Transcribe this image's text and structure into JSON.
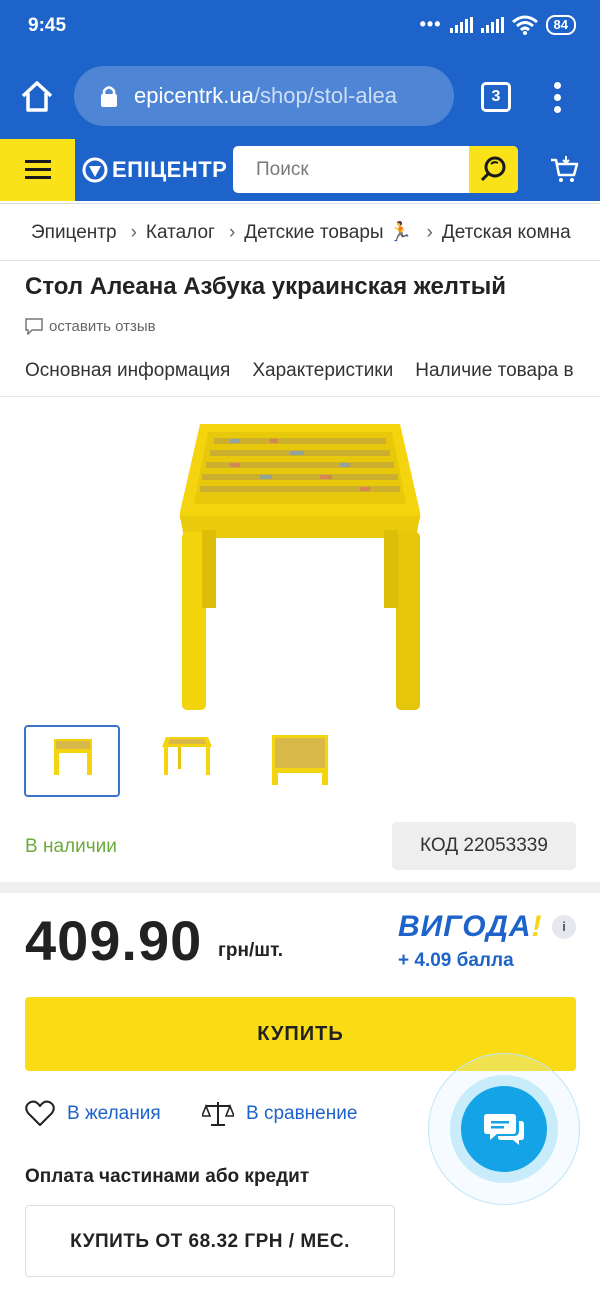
{
  "status_bar": {
    "time": "9:45",
    "battery": "84"
  },
  "browser": {
    "url_domain": "epicentrk.ua",
    "url_path": "/shop/stol-alea",
    "tab_count": "3"
  },
  "site_header": {
    "logo_text": "ЕПІЦЕНТР",
    "search_placeholder": "Поиск"
  },
  "breadcrumbs": [
    "Эпицентр",
    "Каталог",
    "Детские товары 🏃",
    "Детская комна"
  ],
  "product": {
    "title": "Стол Алеана Азбука украинская желтый",
    "review_link": "оставить отзыв",
    "tabs": [
      "Основная информация",
      "Характеристики",
      "Наличие товара в"
    ],
    "availability": "В наличии",
    "code": "КОД 22053339",
    "price": "409.90",
    "unit": "грн/шт.",
    "bonus_brand": "ВИГОДА",
    "bonus_brand_mark": "!",
    "bonus_points": "+ 4.09 балла",
    "info_icon_text": "i",
    "buy_label": "КУПИТЬ",
    "wishlist_label": "В желания",
    "compare_label": "В сравнение",
    "credit_title": "Оплата частинами або кредит",
    "credit_button": "КУПИТЬ ОТ 68.32 ГРН / МЕС."
  },
  "colors": {
    "brand_blue": "#1e63c9",
    "brand_yellow": "#f9dc16",
    "in_stock_green": "#6bab3a",
    "chat_blue": "#13a3e6"
  },
  "icons": [
    "home-icon",
    "lock-icon",
    "tabs-icon",
    "more-vert-icon",
    "menu-icon",
    "logo-mark-icon",
    "search-icon",
    "cart-icon",
    "chat-bubble-icon",
    "heart-icon",
    "scales-icon",
    "chat-icon",
    "info-icon"
  ]
}
